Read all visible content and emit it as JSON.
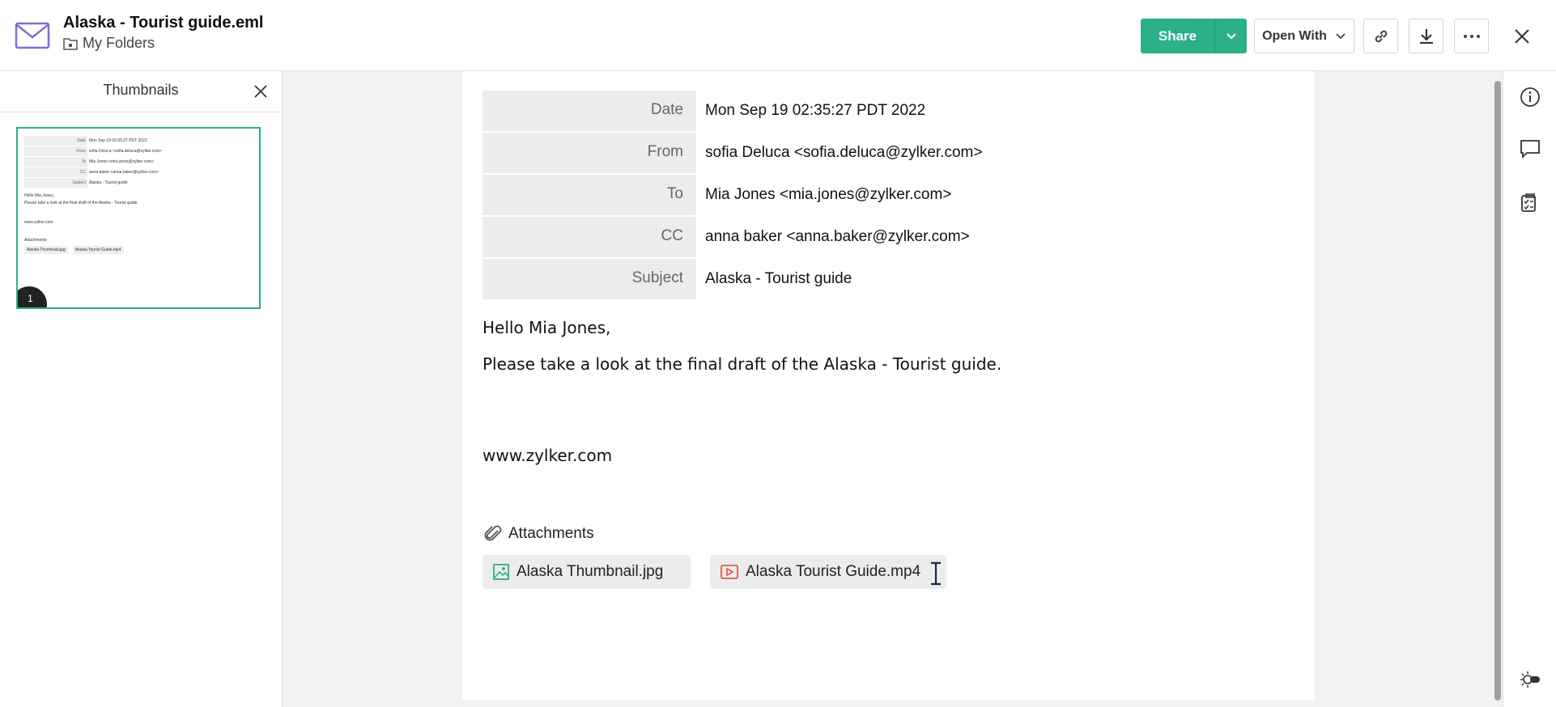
{
  "header": {
    "title": "Alaska - Tourist guide.eml",
    "folder": "My Folders",
    "share_label": "Share",
    "open_with_label": "Open With"
  },
  "thumbnails": {
    "title": "Thumbnails",
    "page_number": "1"
  },
  "email": {
    "fields": [
      {
        "label": "Date",
        "value": "Mon Sep 19 02:35:27 PDT 2022"
      },
      {
        "label": "From",
        "value": "sofia Deluca <sofia.deluca@zylker.com>"
      },
      {
        "label": "To",
        "value": "Mia Jones <mia.jones@zylker.com>"
      },
      {
        "label": "CC",
        "value": "anna baker <anna.baker@zylker.com>"
      },
      {
        "label": "Subject",
        "value": "Alaska - Tourist guide"
      }
    ],
    "greeting": "Hello Mia Jones,",
    "body": "Please take a look at the final draft of the Alaska - Tourist guide.",
    "signature": "www.zylker.com",
    "attachments_label": "Attachments",
    "attachments": [
      {
        "name": "Alaska Thumbnail.jpg",
        "icon": "image-file-icon"
      },
      {
        "name": "Alaska Tourist Guide.mp4",
        "icon": "video-file-icon"
      }
    ]
  },
  "colors": {
    "accent": "#2bb08a",
    "video_icon": "#e05a4a",
    "image_icon": "#2bb08a"
  }
}
